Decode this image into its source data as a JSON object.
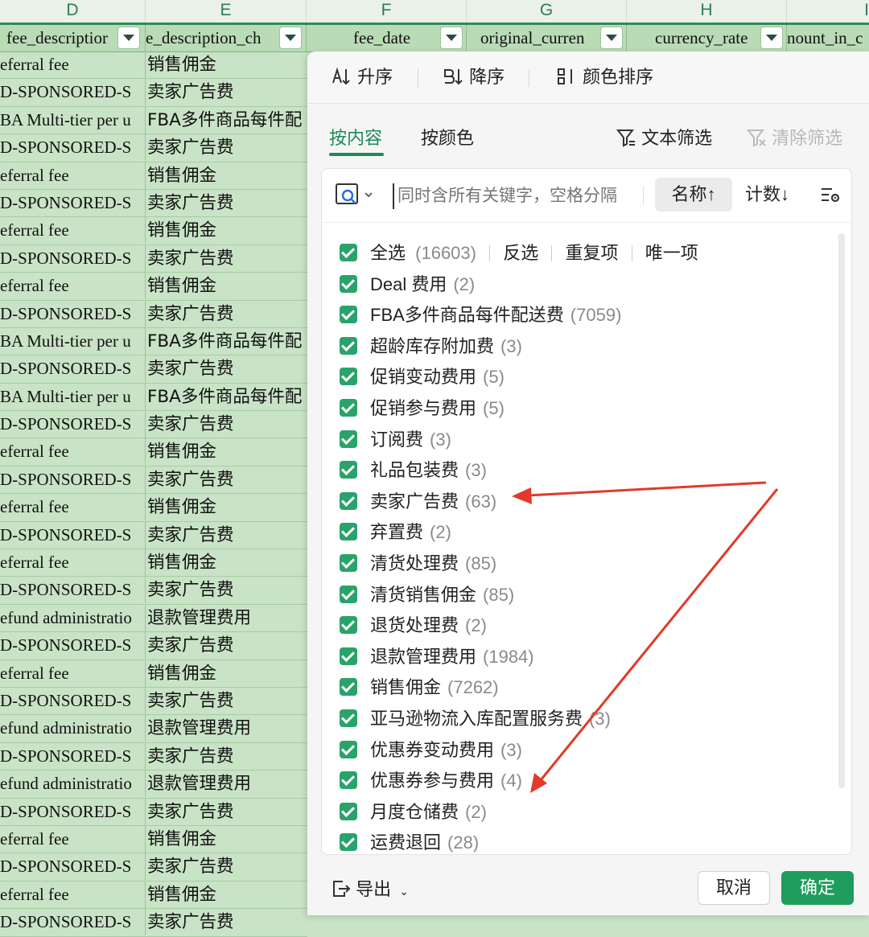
{
  "columns": {
    "letters": [
      "D",
      "E",
      "F",
      "G",
      "H",
      "I"
    ],
    "headers": [
      "fee_descriptior",
      "e_description_ch",
      "fee_date",
      "original_curren",
      "currency_rate",
      "nount_in_c"
    ]
  },
  "rows": [
    {
      "d": "eferral fee",
      "e": "销售佣金"
    },
    {
      "d": "D-SPONSORED-S",
      "e": "卖家广告费"
    },
    {
      "d": "BA Multi-tier per u",
      "e": "FBA多件商品每件配"
    },
    {
      "d": "D-SPONSORED-S",
      "e": "卖家广告费"
    },
    {
      "d": "eferral fee",
      "e": "销售佣金"
    },
    {
      "d": "D-SPONSORED-S",
      "e": "卖家广告费"
    },
    {
      "d": "eferral fee",
      "e": "销售佣金"
    },
    {
      "d": "D-SPONSORED-S",
      "e": "卖家广告费"
    },
    {
      "d": "eferral fee",
      "e": "销售佣金"
    },
    {
      "d": "D-SPONSORED-S",
      "e": "卖家广告费"
    },
    {
      "d": "BA Multi-tier per u",
      "e": "FBA多件商品每件配"
    },
    {
      "d": "D-SPONSORED-S",
      "e": "卖家广告费"
    },
    {
      "d": "BA Multi-tier per u",
      "e": "FBA多件商品每件配"
    },
    {
      "d": "D-SPONSORED-S",
      "e": "卖家广告费"
    },
    {
      "d": "eferral fee",
      "e": "销售佣金"
    },
    {
      "d": "D-SPONSORED-S",
      "e": "卖家广告费"
    },
    {
      "d": "eferral fee",
      "e": "销售佣金"
    },
    {
      "d": "D-SPONSORED-S",
      "e": "卖家广告费"
    },
    {
      "d": "eferral fee",
      "e": "销售佣金"
    },
    {
      "d": "D-SPONSORED-S",
      "e": "卖家广告费"
    },
    {
      "d": "efund administratio",
      "e": "退款管理费用"
    },
    {
      "d": "D-SPONSORED-S",
      "e": "卖家广告费"
    },
    {
      "d": "eferral fee",
      "e": "销售佣金"
    },
    {
      "d": "D-SPONSORED-S",
      "e": "卖家广告费"
    },
    {
      "d": "efund administratio",
      "e": "退款管理费用"
    },
    {
      "d": "D-SPONSORED-S",
      "e": "卖家广告费"
    },
    {
      "d": "efund administratio",
      "e": "退款管理费用"
    },
    {
      "d": "D-SPONSORED-S",
      "e": "卖家广告费"
    },
    {
      "d": "eferral fee",
      "e": "销售佣金"
    },
    {
      "d": "D-SPONSORED-S",
      "e": "卖家广告费"
    },
    {
      "d": "eferral fee",
      "e": "销售佣金"
    },
    {
      "d": "D-SPONSORED-S",
      "e": "卖家广告费"
    }
  ],
  "panel": {
    "sort": {
      "asc": "升序",
      "desc": "降序",
      "color": "颜色排序"
    },
    "tabs": {
      "by_content": "按内容",
      "by_color": "按颜色"
    },
    "text_filter": "文本筛选",
    "clear_filter": "清除筛选",
    "search": {
      "placeholder": "同时含所有关键字，空格分隔",
      "name_sort": "名称↑",
      "count_sort": "计数↓"
    },
    "select_all": {
      "label": "全选",
      "count": "(16603)",
      "invert": "反选",
      "duplicates": "重复项",
      "unique": "唯一项"
    },
    "items": [
      {
        "label": "Deal 费用",
        "count": "(2)"
      },
      {
        "label": "FBA多件商品每件配送费",
        "count": "(7059)"
      },
      {
        "label": "超龄库存附加费",
        "count": "(3)"
      },
      {
        "label": "促销变动费用",
        "count": "(5)"
      },
      {
        "label": "促销参与费用",
        "count": "(5)"
      },
      {
        "label": "订阅费",
        "count": "(3)"
      },
      {
        "label": "礼品包装费",
        "count": "(3)"
      },
      {
        "label": "卖家广告费",
        "count": "(63)"
      },
      {
        "label": "弃置费",
        "count": "(2)"
      },
      {
        "label": "清货处理费",
        "count": "(85)"
      },
      {
        "label": "清货销售佣金",
        "count": "(85)"
      },
      {
        "label": "退货处理费",
        "count": "(2)"
      },
      {
        "label": "退款管理费用",
        "count": "(1984)"
      },
      {
        "label": "销售佣金",
        "count": "(7262)"
      },
      {
        "label": "亚马逊物流入库配置服务费",
        "count": "(3)"
      },
      {
        "label": "优惠券变动费用",
        "count": "(3)"
      },
      {
        "label": "优惠券参与费用",
        "count": "(4)"
      },
      {
        "label": "月度仓储费",
        "count": "(2)"
      },
      {
        "label": "运费退回",
        "count": "(28)"
      }
    ],
    "footer": {
      "export": "导出",
      "cancel": "取消",
      "ok": "确定"
    }
  },
  "colors": {
    "accent": "#1f9d5d",
    "annotation_arrow": "#e03a2a",
    "cell_fill": "#c9e3c6"
  }
}
